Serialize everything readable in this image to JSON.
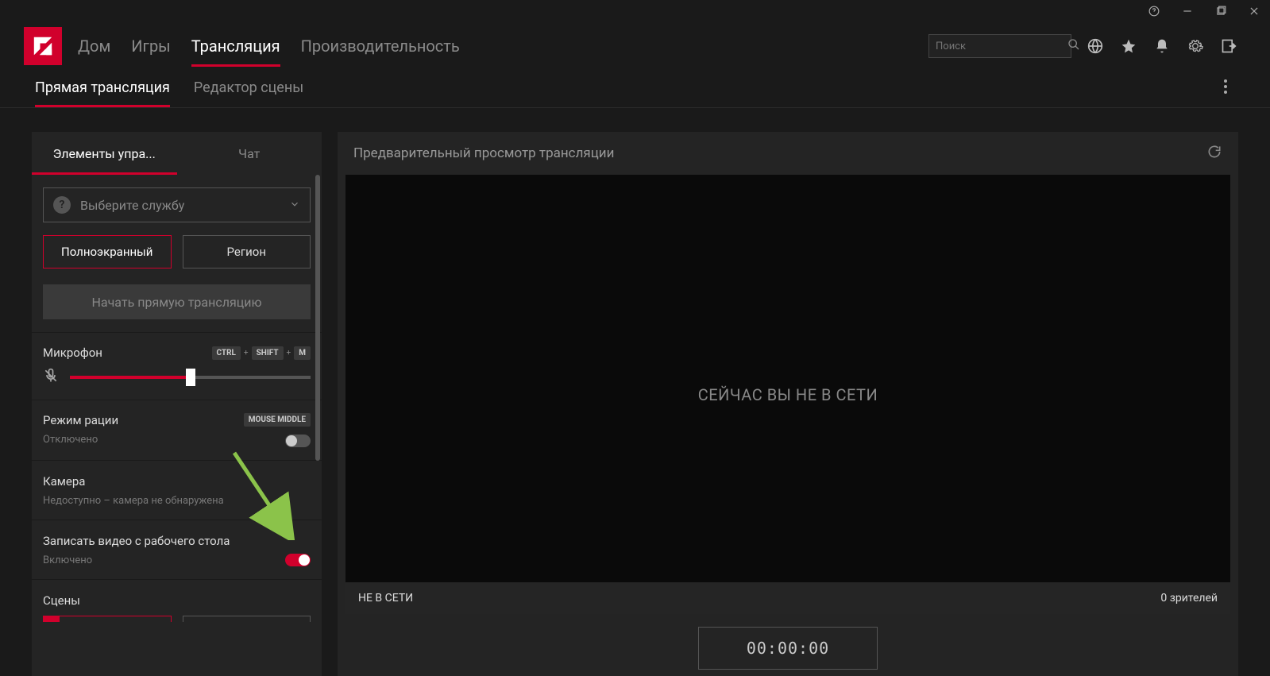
{
  "window": {
    "help_icon": "help",
    "minimize_icon": "minimize",
    "maximize_icon": "maximize",
    "close_icon": "close"
  },
  "nav": {
    "tabs": [
      {
        "label": "Дом",
        "active": false
      },
      {
        "label": "Игры",
        "active": false
      },
      {
        "label": "Трансляция",
        "active": true
      },
      {
        "label": "Производительность",
        "active": false
      }
    ],
    "search_placeholder": "Поиск",
    "icons": [
      "globe",
      "star",
      "bell",
      "gear",
      "logout"
    ]
  },
  "subnav": {
    "tabs": [
      {
        "label": "Прямая трансляция",
        "active": true
      },
      {
        "label": "Редактор сцены",
        "active": false
      }
    ]
  },
  "sidebar": {
    "tabs": [
      {
        "label": "Элементы упра...",
        "active": true
      },
      {
        "label": "Чат",
        "active": false
      }
    ],
    "service_placeholder": "Выберите службу",
    "mode": {
      "fullscreen": "Полноэкранный",
      "region": "Регион"
    },
    "start_label": "Начать прямую трансляцию",
    "mic": {
      "label": "Микрофон",
      "hotkeys": [
        "CTRL",
        "SHIFT",
        "M"
      ],
      "value_pct": 50
    },
    "ptt": {
      "label": "Режим рации",
      "hotkey": "MOUSE MIDDLE",
      "status": "Отключено",
      "on": false
    },
    "camera": {
      "label": "Камера",
      "status": "Недоступно – камера не обнаружена"
    },
    "record": {
      "label": "Записать видео с рабочего стола",
      "status": "Включено",
      "on": true
    },
    "scenes": {
      "label": "Сцены",
      "active_index": 1
    }
  },
  "preview": {
    "title": "Предварительный просмотр трансляции",
    "offline_msg": "СЕЙЧАС ВЫ НЕ В СЕТИ",
    "status": "НЕ В СЕТИ",
    "viewers": "0 зрителей",
    "timer": "00:00:00"
  }
}
